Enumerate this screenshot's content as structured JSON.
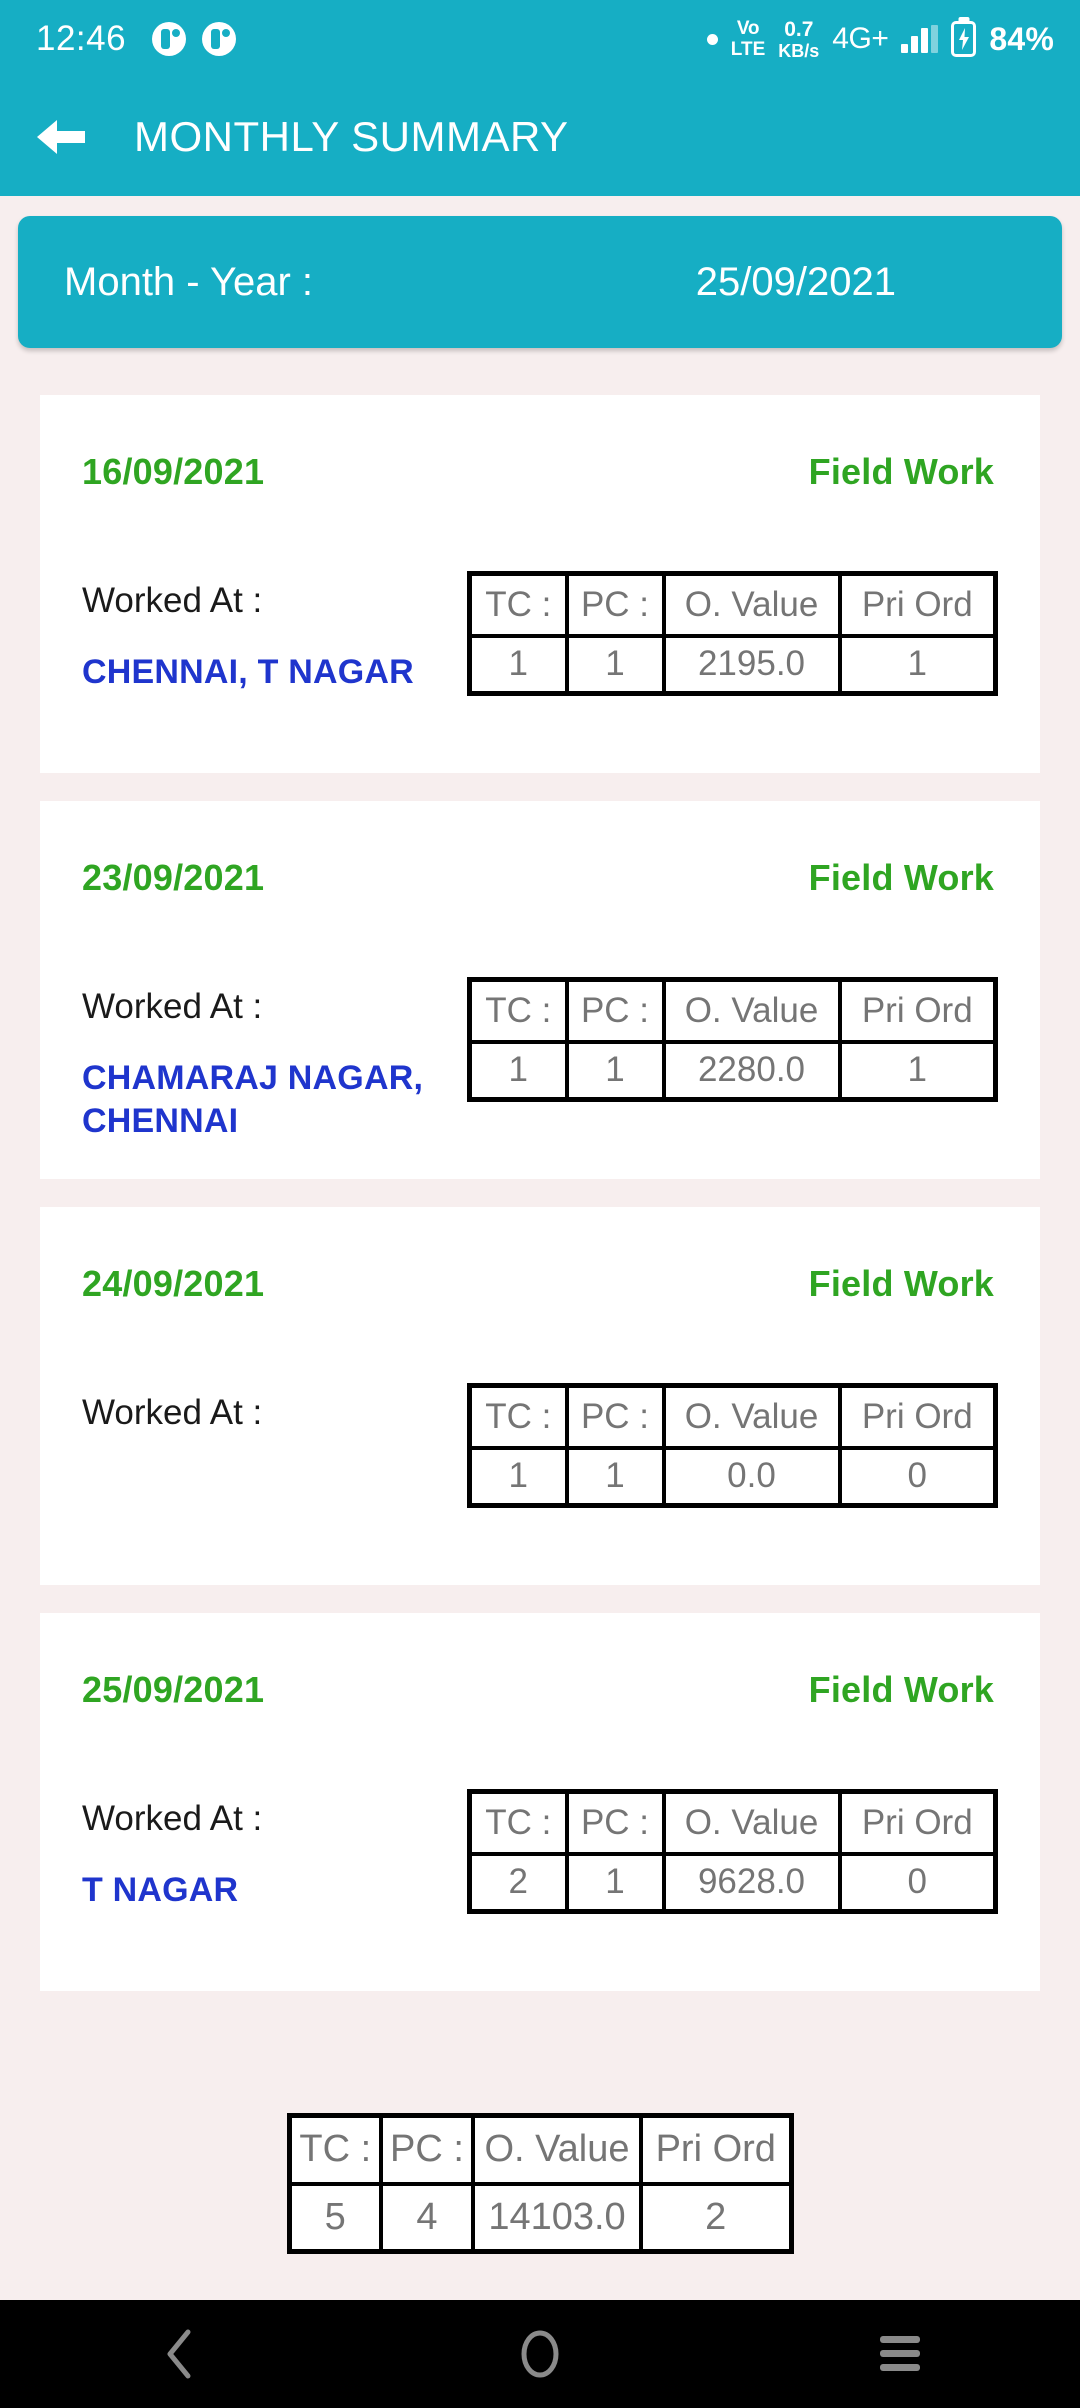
{
  "status_bar": {
    "time": "12:46",
    "notification_icons": [
      "notification-circle-icon",
      "notification-circle-icon"
    ],
    "volte_line1": "Vo",
    "volte_line2": "LTE",
    "net_speed_value": "0.7",
    "net_speed_unit": "KB/s",
    "network_type": "4G+",
    "battery_percent": "84%"
  },
  "app_bar": {
    "back_icon": "arrow-left-icon",
    "title": "MONTHLY SUMMARY"
  },
  "month_banner": {
    "label": "Month - Year :",
    "value": "25/09/2021"
  },
  "table_headers": {
    "tc": "TC :",
    "pc": "PC :",
    "o_value": "O. Value",
    "pri_ord": "Pri Ord"
  },
  "worked_at_label": "Worked At :",
  "cards": [
    {
      "date": "16/09/2021",
      "work_type": "Field Work",
      "place": "CHENNAI, T NAGAR",
      "tc": "1",
      "pc": "1",
      "o_value": "2195.0",
      "pri_ord": "1"
    },
    {
      "date": "23/09/2021",
      "work_type": "Field Work",
      "place": "CHAMARAJ NAGAR, CHENNAI",
      "tc": "1",
      "pc": "1",
      "o_value": "2280.0",
      "pri_ord": "1"
    },
    {
      "date": "24/09/2021",
      "work_type": "Field Work",
      "place": "",
      "tc": "1",
      "pc": "1",
      "o_value": "0.0",
      "pri_ord": "0"
    },
    {
      "date": "25/09/2021",
      "work_type": "Field Work",
      "place": "T NAGAR",
      "tc": "2",
      "pc": "1",
      "o_value": "9628.0",
      "pri_ord": "0"
    }
  ],
  "totals": {
    "tc": "5",
    "pc": "4",
    "o_value": "14103.0",
    "pri_ord": "2"
  },
  "nav_bar": {
    "back": "back-chevron-icon",
    "home": "home-circle-icon",
    "recents": "recents-menu-icon"
  },
  "colors": {
    "teal": "#16aec4",
    "green": "#2fa522",
    "blue": "#1f35cd",
    "page_bg": "#f7eeee",
    "table_text": "#757575"
  }
}
